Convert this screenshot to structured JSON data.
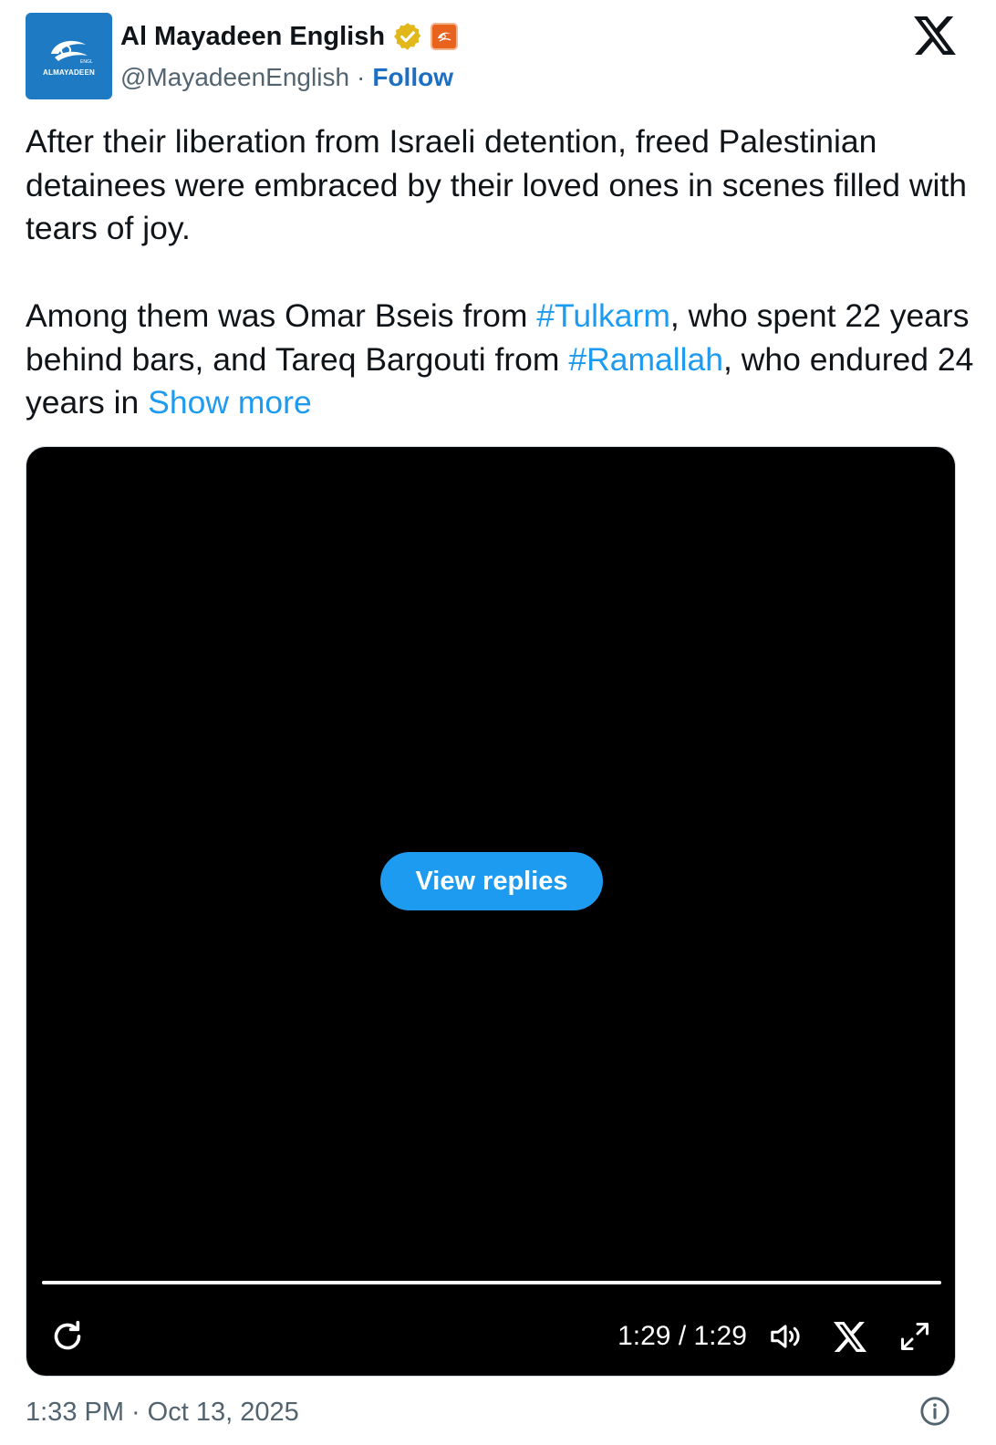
{
  "author": {
    "avatar_text": "ALMAYADEEN",
    "display_name": "Al Mayadeen English",
    "handle": "@MayadeenEnglish",
    "separator": "·",
    "follow_label": "Follow",
    "verified_icon": "verified-gold-badge-icon",
    "affiliate_icon": "almayadeen-affiliate-badge-icon"
  },
  "platform_icon": "x-logo-icon",
  "tweet": {
    "para1": "After their liberation from Israeli detention, freed Palestinian detainees were embraced by their loved ones in scenes filled with tears of joy.",
    "para2_a": "Among them was Omar Bseis from ",
    "hashtag1": "#Tulkarm",
    "para2_b": ", who spent 22 years behind bars, and Tareq Bargouti from ",
    "hashtag2": "#Ramallah",
    "para2_c": ", who endured 24 years in ",
    "show_more": "Show more"
  },
  "video": {
    "view_replies_label": "View replies",
    "time_display": "1:29 / 1:29",
    "progress": 1.0,
    "replay_icon": "replay-icon",
    "volume_icon": "volume-icon",
    "x_icon": "x-logo-icon",
    "fullscreen_icon": "fullscreen-icon"
  },
  "footer": {
    "time": "1:33 PM",
    "separator": "·",
    "date": "Oct 13, 2025",
    "info_icon": "info-icon"
  },
  "colors": {
    "link": "#1d9bf0",
    "follow": "#1d6fc4",
    "avatar_bg": "#1f7ac4",
    "verified": "#e2b719"
  }
}
